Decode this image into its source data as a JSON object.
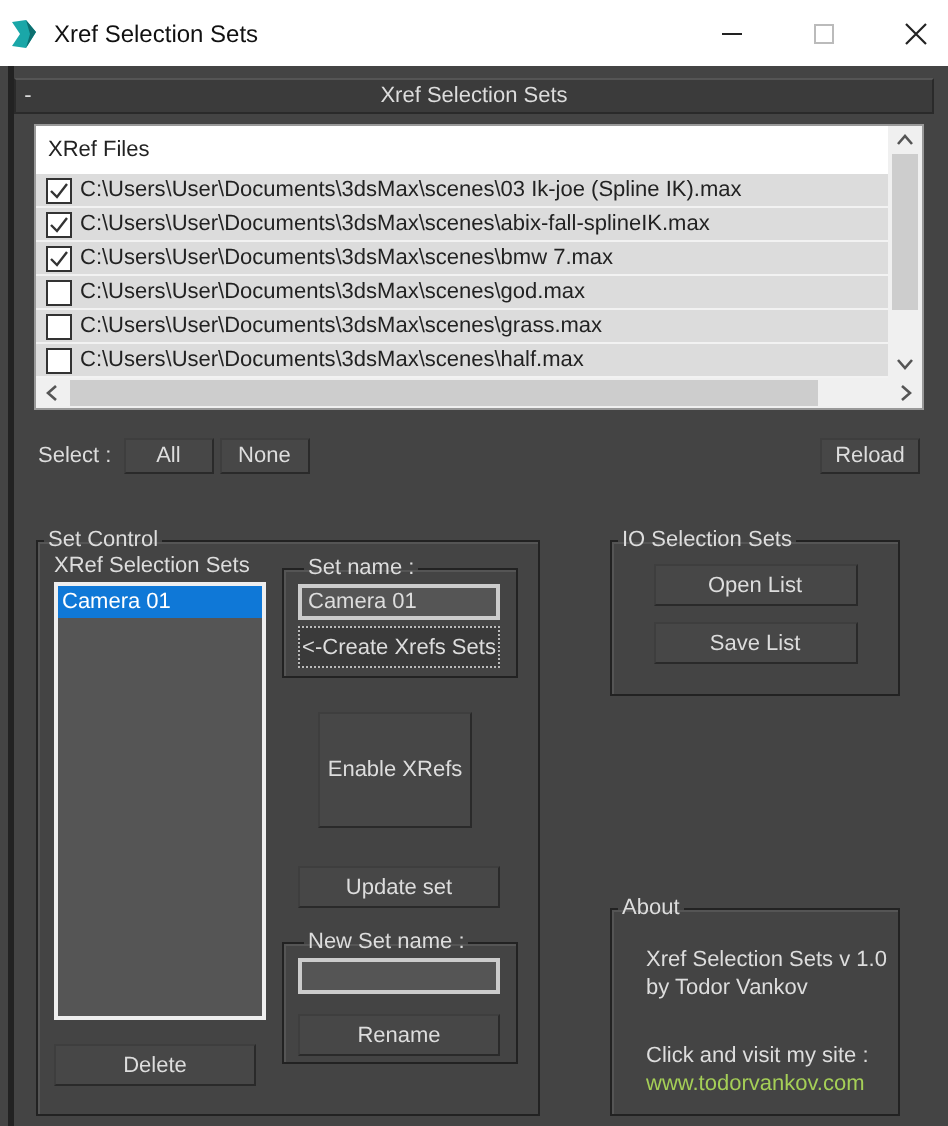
{
  "window": {
    "title": "Xref Selection Sets"
  },
  "rollout": {
    "collapse_symbol": "-",
    "title": "Xref Selection Sets"
  },
  "xref_files": {
    "header": "XRef Files",
    "rows": [
      {
        "path": "C:\\Users\\User\\Documents\\3dsMax\\scenes\\03 Ik-joe (Spline IK).max",
        "checked": true
      },
      {
        "path": "C:\\Users\\User\\Documents\\3dsMax\\scenes\\abix-fall-splineIK.max",
        "checked": true
      },
      {
        "path": "C:\\Users\\User\\Documents\\3dsMax\\scenes\\bmw 7.max",
        "checked": true
      },
      {
        "path": "C:\\Users\\User\\Documents\\3dsMax\\scenes\\god.max",
        "checked": false
      },
      {
        "path": "C:\\Users\\User\\Documents\\3dsMax\\scenes\\grass.max",
        "checked": false
      },
      {
        "path": "C:\\Users\\User\\Documents\\3dsMax\\scenes\\half.max",
        "checked": false
      }
    ]
  },
  "select": {
    "label": "Select :",
    "buttons": [
      "All",
      "None"
    ],
    "reload": "Reload"
  },
  "set_control": {
    "title": "Set Control",
    "list_label": "XRef Selection Sets",
    "sets": [
      {
        "name": "Camera 01",
        "selected": true
      }
    ],
    "delete": "Delete",
    "set_name": {
      "title": "Set name :",
      "value": "Camera 01",
      "create": "<-Create Xrefs Sets"
    },
    "enable": "Enable XRefs",
    "update": "Update set",
    "new_set_name": {
      "title": "New Set name :",
      "rename": "Rename"
    }
  },
  "io_selection_sets": {
    "title": "IO Selection Sets",
    "buttons": [
      "Open List",
      "Save List"
    ]
  },
  "about": {
    "title": "About",
    "lines": [
      "Xref Selection Sets v 1.0",
      "by Todor Vankov"
    ],
    "prompt": "Click and visit my site :",
    "link": "www.todorvankov.com"
  }
}
